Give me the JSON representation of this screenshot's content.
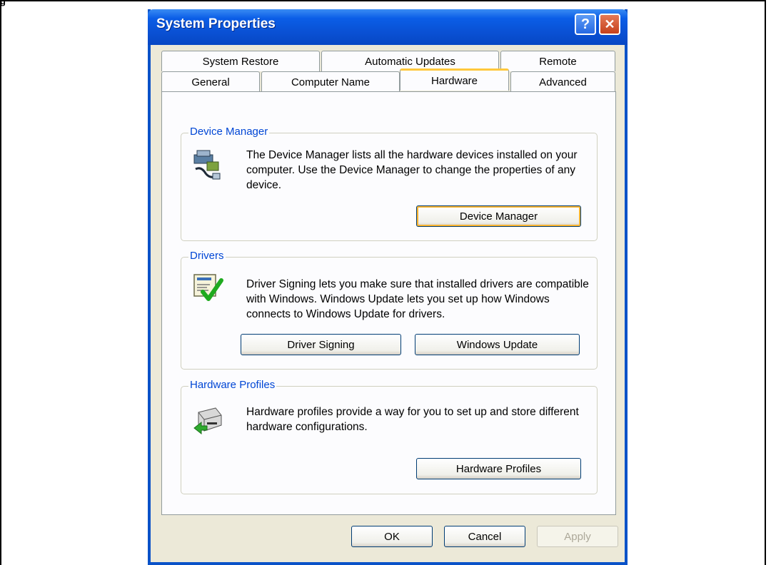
{
  "page": {
    "corner_label": "g"
  },
  "window": {
    "title": "System Properties",
    "help_glyph": "?",
    "close_glyph": "✕"
  },
  "tabs": {
    "row1": [
      "System Restore",
      "Automatic Updates",
      "Remote"
    ],
    "row2": [
      "General",
      "Computer Name",
      "Hardware",
      "Advanced"
    ],
    "active": "Hardware"
  },
  "device_manager": {
    "label": "Device Manager",
    "text": "The Device Manager lists all the hardware devices installed on your computer. Use the Device Manager to change the properties of any device.",
    "button": "Device Manager",
    "icon": "device-manager-icon"
  },
  "drivers": {
    "label": "Drivers",
    "text": "Driver Signing lets you make sure that installed drivers are compatible with Windows. Windows Update lets you set up how Windows connects to Windows Update for drivers.",
    "button_signing": "Driver Signing",
    "button_update": "Windows Update",
    "icon": "driver-signing-icon"
  },
  "hardware_profiles": {
    "label": "Hardware Profiles",
    "text": "Hardware profiles provide a way for you to set up and store different hardware configurations.",
    "button": "Hardware Profiles",
    "icon": "hardware-profiles-icon"
  },
  "footer": {
    "ok": "OK",
    "cancel": "Cancel",
    "apply": "Apply"
  },
  "colors": {
    "titlebar": "#0a52d6",
    "group_label": "#0046d5",
    "focus": "#f8b330"
  }
}
